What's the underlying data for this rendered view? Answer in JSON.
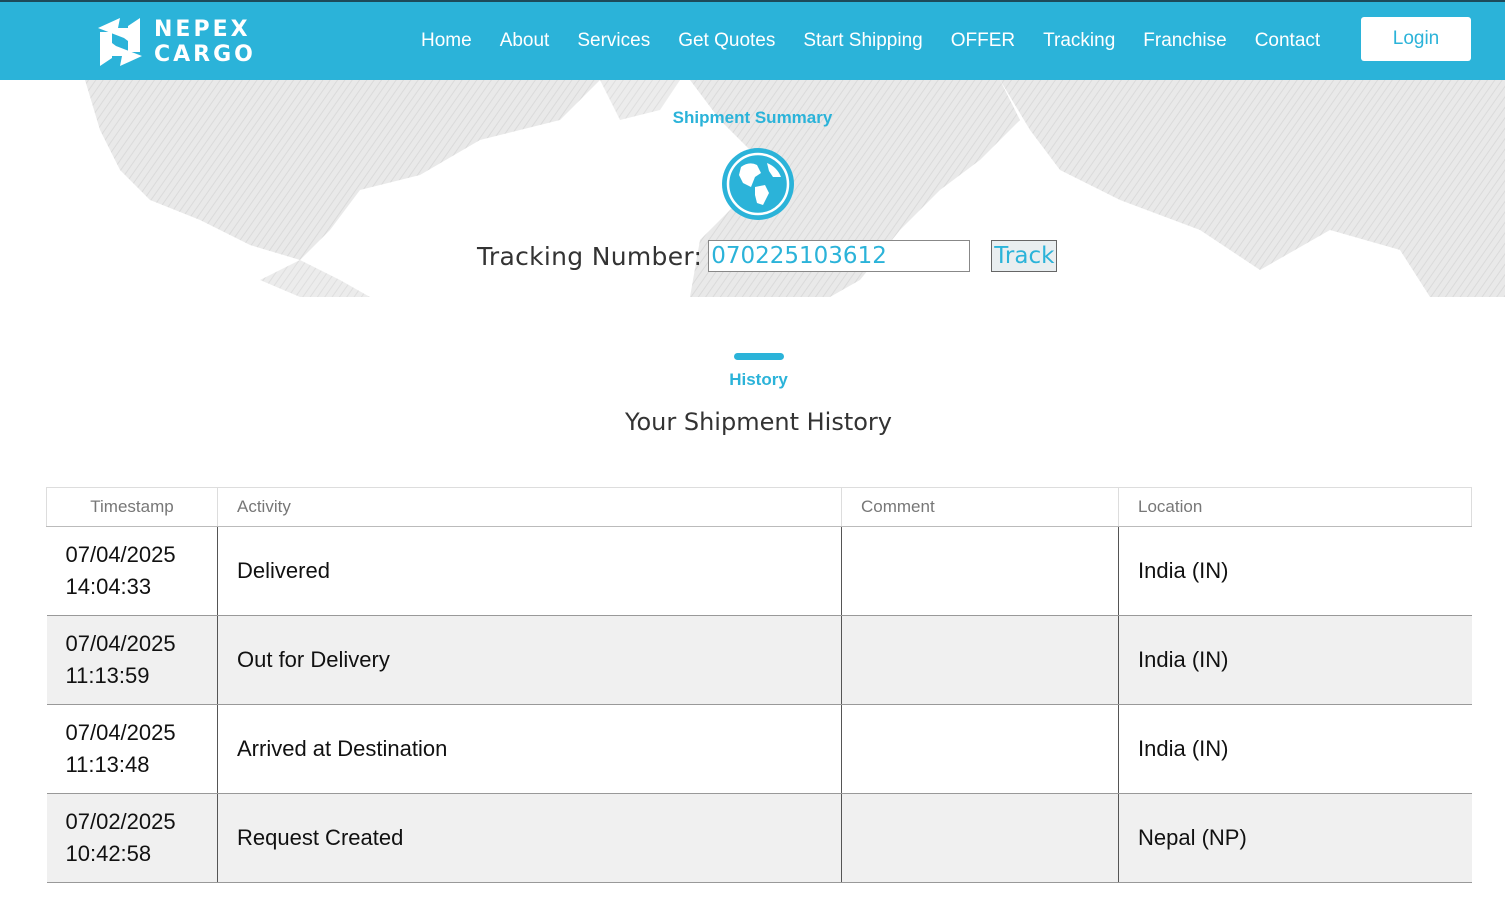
{
  "brand": {
    "line1": "NEPEX",
    "line2": "CARGO"
  },
  "nav": {
    "items": [
      "Home",
      "About",
      "Services",
      "Get Quotes",
      "Start Shipping",
      "OFFER",
      "Tracking",
      "Franchise",
      "Contact"
    ],
    "login": "Login"
  },
  "hero": {
    "summary_label": "Shipment Summary",
    "tracking_label": "Tracking Number:",
    "tracking_value": "070225103612",
    "track_button": "Track"
  },
  "history": {
    "label": "History",
    "subtitle": "Your Shipment History",
    "columns": [
      "Timestamp",
      "Activity",
      "Comment",
      "Location"
    ],
    "rows": [
      {
        "date": "07/04/2025",
        "time": "14:04:33",
        "activity": "Delivered",
        "comment": "",
        "location": "India (IN)"
      },
      {
        "date": "07/04/2025",
        "time": "11:13:59",
        "activity": "Out for Delivery",
        "comment": "",
        "location": "India (IN)"
      },
      {
        "date": "07/04/2025",
        "time": "11:13:48",
        "activity": "Arrived at Destination",
        "comment": "",
        "location": "India (IN)"
      },
      {
        "date": "07/02/2025",
        "time": "10:42:58",
        "activity": "Request Created",
        "comment": "",
        "location": "Nepal (NP)"
      }
    ]
  },
  "colors": {
    "accent": "#2bb3d9",
    "row_alt": "#f0f0f0"
  }
}
